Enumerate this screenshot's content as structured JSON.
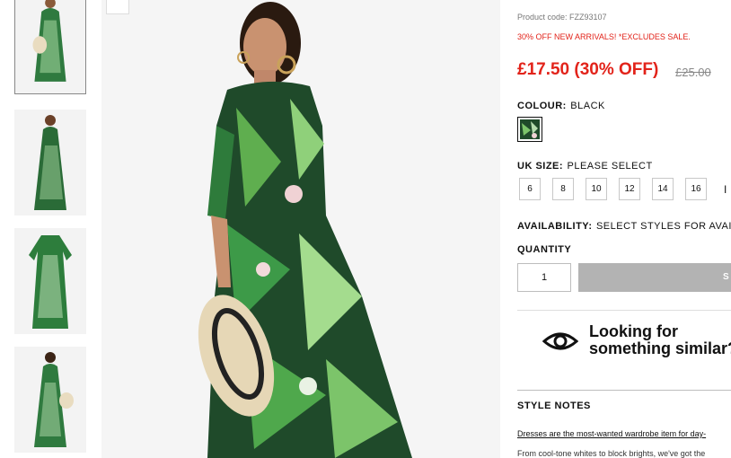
{
  "product": {
    "code_label": "Product code: FZZ93107",
    "promo": "30% OFF NEW ARRIVALS! *EXCLUDES SALE.",
    "price": "£17.50 (30% OFF)",
    "old_price": "£25.00"
  },
  "colour": {
    "label": "COLOUR:",
    "value": "BLACK"
  },
  "size": {
    "label": "UK SIZE:",
    "value": "PLEASE SELECT",
    "options": [
      "6",
      "8",
      "10",
      "12",
      "14",
      "16"
    ],
    "overflow_text": "I"
  },
  "availability": {
    "label": "AVAILABILITY:",
    "value": "SELECT STYLES FOR AVAILA"
  },
  "quantity": {
    "label": "QUANTITY",
    "value": "1"
  },
  "add_button": {
    "label": "S"
  },
  "similar": {
    "line1": "Looking for",
    "line2": "something similar?"
  },
  "style_notes": {
    "heading": "STYLE NOTES",
    "line1": "Dresses are the most-wanted wardrobe item for day-",
    "line2": "From cool-tone whites to block brights, we've got the"
  },
  "colors": {
    "price_red": "#e2231a",
    "button_grey": "#b3b3b3",
    "leaf_green": "#1f7a3a"
  }
}
